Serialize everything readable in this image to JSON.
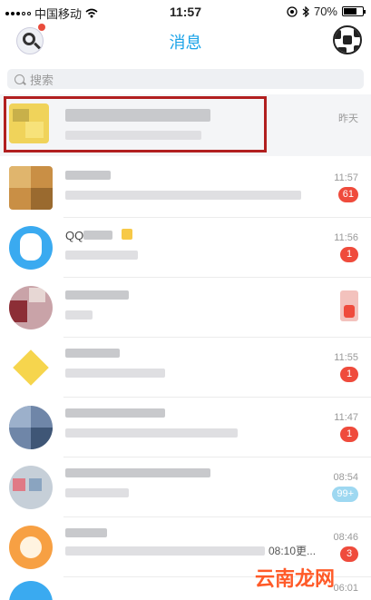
{
  "status_bar": {
    "carrier": "中国移动",
    "time": "11:57",
    "battery": "70%",
    "battery_level": 0.7
  },
  "header": {
    "title": "消息"
  },
  "search": {
    "placeholder": "搜索"
  },
  "conversations": [
    {
      "time": "昨天",
      "badge": ""
    },
    {
      "time": "11:57",
      "badge": "61"
    },
    {
      "name_fragment": "QQ",
      "time": "11:56",
      "badge": "1"
    },
    {
      "time": "",
      "badge": ""
    },
    {
      "time": "11:55",
      "badge": "1"
    },
    {
      "time": "11:47",
      "badge": "1"
    },
    {
      "time": "08:54",
      "badge": "99+"
    },
    {
      "time": "08:46",
      "badge": "3",
      "preview_fragment": "08:10更..."
    },
    {
      "time": "06:01",
      "badge": ""
    }
  ],
  "watermark": "云南龙网",
  "colors": {
    "accent": "#1aa3e8",
    "badge": "#ef4b3c",
    "highlight": "#b11f1f"
  }
}
